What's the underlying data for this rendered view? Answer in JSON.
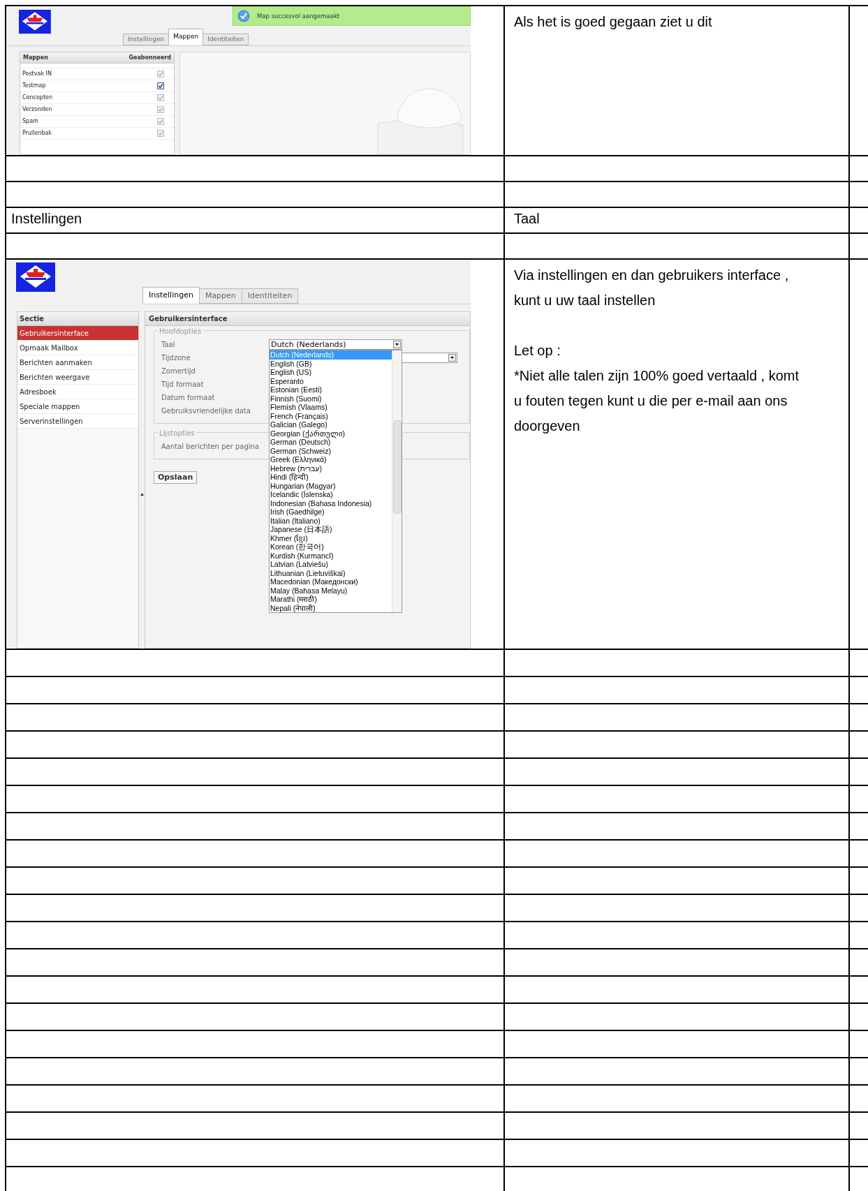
{
  "table": {
    "rows": [
      {
        "kind": "screenshot",
        "screenshot": {
          "kind": "folders",
          "notification": "Map succesvol aangemaakt",
          "tabs": [
            {
              "label": "Instellingen",
              "selected": false
            },
            {
              "label": "Mappen",
              "selected": true
            },
            {
              "label": "Identiteiten",
              "selected": false
            }
          ],
          "folder_list": {
            "columns": [
              "Mappen",
              "Geabonneerd"
            ],
            "rows": [
              {
                "name": "Postvak IN",
                "checked": true,
                "disabled": true
              },
              {
                "name": "Testmap",
                "checked": true,
                "disabled": false
              },
              {
                "name": "Concepten",
                "checked": true,
                "disabled": true
              },
              {
                "name": "Verzonden",
                "checked": true,
                "disabled": true
              },
              {
                "name": "Spam",
                "checked": true,
                "disabled": true
              },
              {
                "name": "Prullenbak",
                "checked": true,
                "disabled": true
              }
            ]
          }
        },
        "column_2": [
          [
            "Als het is goed gegaan ziet u dit"
          ]
        ]
      },
      {
        "kind": "empty"
      },
      {
        "kind": "empty"
      },
      {
        "kind": "text",
        "column_1": "Instellingen",
        "column_2": "Taal"
      },
      {
        "kind": "empty"
      },
      {
        "kind": "screenshot",
        "screenshot": {
          "kind": "settings",
          "tabs": [
            {
              "label": "Instellingen",
              "selected": true
            },
            {
              "label": "Mappen",
              "selected": false
            },
            {
              "label": "Identiteiten",
              "selected": false
            }
          ],
          "section_list": {
            "header": "Sectie",
            "items": [
              {
                "label": "Gebruikersinterface",
                "selected": true
              },
              {
                "label": "Opmaak Mailbox",
                "selected": false
              },
              {
                "label": "Berichten aanmaken",
                "selected": false
              },
              {
                "label": "Berichten weergave",
                "selected": false
              },
              {
                "label": "Adresboek",
                "selected": false
              },
              {
                "label": "Speciale mappen",
                "selected": false
              },
              {
                "label": "Serverinstellingen",
                "selected": false
              }
            ]
          },
          "panel": {
            "title": "Gebruikersinterface",
            "fieldsets": [
              {
                "legend": "Hoofdopties",
                "fields": [
                  {
                    "label": "Taal",
                    "kind": "select",
                    "value": "Dutch (Nederlands)",
                    "expanded": true,
                    "options": [
                      {
                        "label": "Dutch (Nederlands)",
                        "selected": true
                      },
                      {
                        "label": "English (GB)",
                        "selected": false
                      },
                      {
                        "label": "English (US)",
                        "selected": false
                      },
                      {
                        "label": "Esperanto",
                        "selected": false
                      },
                      {
                        "label": "Estonian (Eesti)",
                        "selected": false
                      },
                      {
                        "label": "Finnish (Suomi)",
                        "selected": false
                      },
                      {
                        "label": "Flemish (Vlaams)",
                        "selected": false
                      },
                      {
                        "label": "French (Français)",
                        "selected": false
                      },
                      {
                        "label": "Galician (Galego)",
                        "selected": false
                      },
                      {
                        "label": "Georgian (ქართული)",
                        "selected": false
                      },
                      {
                        "label": "German (Deutsch)",
                        "selected": false
                      },
                      {
                        "label": "German (Schweiz)",
                        "selected": false
                      },
                      {
                        "label": "Greek (Ελληνικά)",
                        "selected": false
                      },
                      {
                        "label": "Hebrew (עברית)",
                        "selected": false
                      },
                      {
                        "label": "Hindi (हिन्दी)",
                        "selected": false
                      },
                      {
                        "label": "Hungarian (Magyar)",
                        "selected": false
                      },
                      {
                        "label": "Icelandic (Íslenska)",
                        "selected": false
                      },
                      {
                        "label": "Indonesian (Bahasa Indonesia)",
                        "selected": false
                      },
                      {
                        "label": "Irish (Gaedhilge)",
                        "selected": false
                      },
                      {
                        "label": "Italian (Italiano)",
                        "selected": false
                      },
                      {
                        "label": "Japanese (日本語)",
                        "selected": false
                      },
                      {
                        "label": "Khmer (ខ្មែរ)",
                        "selected": false
                      },
                      {
                        "label": "Korean (한국어)",
                        "selected": false
                      },
                      {
                        "label": "Kurdish (Kurmancî)",
                        "selected": false
                      },
                      {
                        "label": "Latvian (Latviešu)",
                        "selected": false
                      },
                      {
                        "label": "Lithuanian (Lietuviškai)",
                        "selected": false
                      },
                      {
                        "label": "Macedonian (Македонски)",
                        "selected": false
                      },
                      {
                        "label": "Malay (Bahasa Melayu)",
                        "selected": false
                      },
                      {
                        "label": "Marathi (मराठी)",
                        "selected": false
                      },
                      {
                        "label": "Nepali (नेपाली)",
                        "selected": false
                      }
                    ]
                  },
                  {
                    "label": "Tijdzone",
                    "kind": "select",
                    "expanded": false
                  },
                  {
                    "label": "Zomertijd",
                    "kind": "covered"
                  },
                  {
                    "label": "Tijd formaat",
                    "kind": "covered"
                  },
                  {
                    "label": "Datum formaat",
                    "kind": "covered"
                  },
                  {
                    "label": "Gebruiksvriendelijke data",
                    "kind": "covered"
                  }
                ]
              },
              {
                "legend": "Lijstopties",
                "fields": [
                  {
                    "label": "Aantal berichten per pagina",
                    "kind": "covered"
                  }
                ]
              }
            ],
            "button": "Opslaan"
          }
        },
        "column_2": [
          [
            "Via instellingen en dan gebruikers interface , kunt u uw taal instellen"
          ],
          [
            "Let op :",
            "*Niet alle talen zijn 100% goed vertaald , komt u fouten tegen kunt u die per e-mail aan ons doorgeven"
          ]
        ]
      },
      {
        "kind": "empty"
      },
      {
        "kind": "empty"
      },
      {
        "kind": "empty"
      },
      {
        "kind": "empty"
      },
      {
        "kind": "empty"
      },
      {
        "kind": "empty"
      },
      {
        "kind": "empty"
      },
      {
        "kind": "empty"
      },
      {
        "kind": "empty"
      },
      {
        "kind": "empty"
      },
      {
        "kind": "empty"
      },
      {
        "kind": "empty"
      },
      {
        "kind": "empty"
      },
      {
        "kind": "empty"
      },
      {
        "kind": "empty"
      },
      {
        "kind": "empty"
      },
      {
        "kind": "empty"
      },
      {
        "kind": "empty"
      },
      {
        "kind": "empty"
      },
      {
        "kind": "empty"
      }
    ]
  }
}
